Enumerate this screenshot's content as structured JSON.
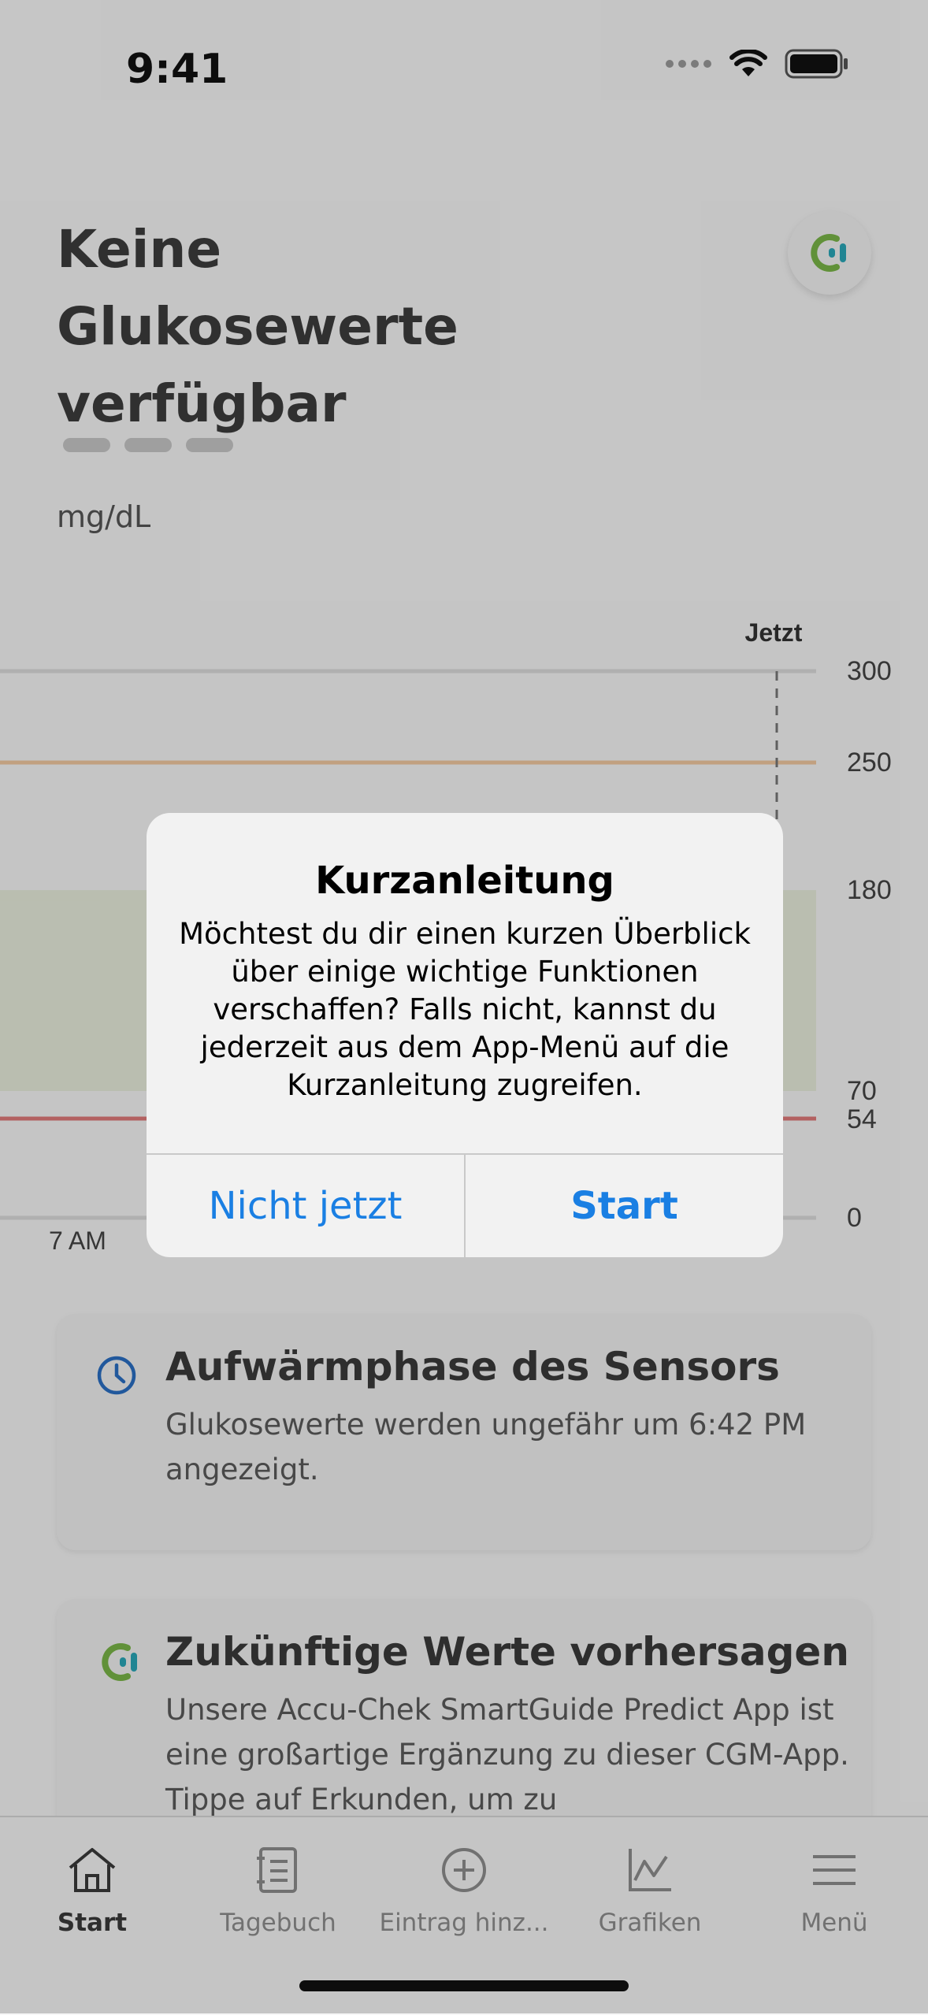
{
  "status_bar": {
    "time": "9:41"
  },
  "header": {
    "title": "Keine Glukosewerte verfügbar",
    "unit": "mg/dL"
  },
  "chart": {
    "now_label": "Jetzt",
    "y_labels": [
      "300",
      "250",
      "180",
      "70",
      "54",
      "0"
    ],
    "x_label": "7 AM",
    "colors": {
      "high_line": "#f2c8a0",
      "low_line": "#e07a7a",
      "target_band": "#e9eedd",
      "grid": "#dcdcdc"
    }
  },
  "cards": [
    {
      "title": "Aufwärmphase des Sensors",
      "text": "Glukosewerte werden ungefähr um 6:42 PM angezeigt."
    },
    {
      "title": "Zukünftige Werte vorhersagen",
      "text": "Unsere Accu-Chek SmartGuide Predict App ist eine großartige Ergänzung zu dieser CGM-App. Tippe auf Erkunden, um zu"
    }
  ],
  "tabs": [
    {
      "label": "Start",
      "icon": "home-icon"
    },
    {
      "label": "Tagebuch",
      "icon": "diary-icon"
    },
    {
      "label": "Eintrag hinz...",
      "icon": "add-entry-icon"
    },
    {
      "label": "Grafiken",
      "icon": "chart-icon"
    },
    {
      "label": "Menü",
      "icon": "menu-icon"
    }
  ],
  "dialog": {
    "title": "Kurzanleitung",
    "message": "Möchtest du dir einen kurzen Überblick über einige wichtige Funktionen verschaffen? Falls nicht, kannst du jederzeit aus dem App-Menü auf die Kurzanleitung zugreifen.",
    "cancel_label": "Nicht jetzt",
    "confirm_label": "Start"
  },
  "colors": {
    "accent": "#1a7fe3",
    "brand_green": "#7ab648",
    "brand_teal": "#2aa7b8"
  }
}
